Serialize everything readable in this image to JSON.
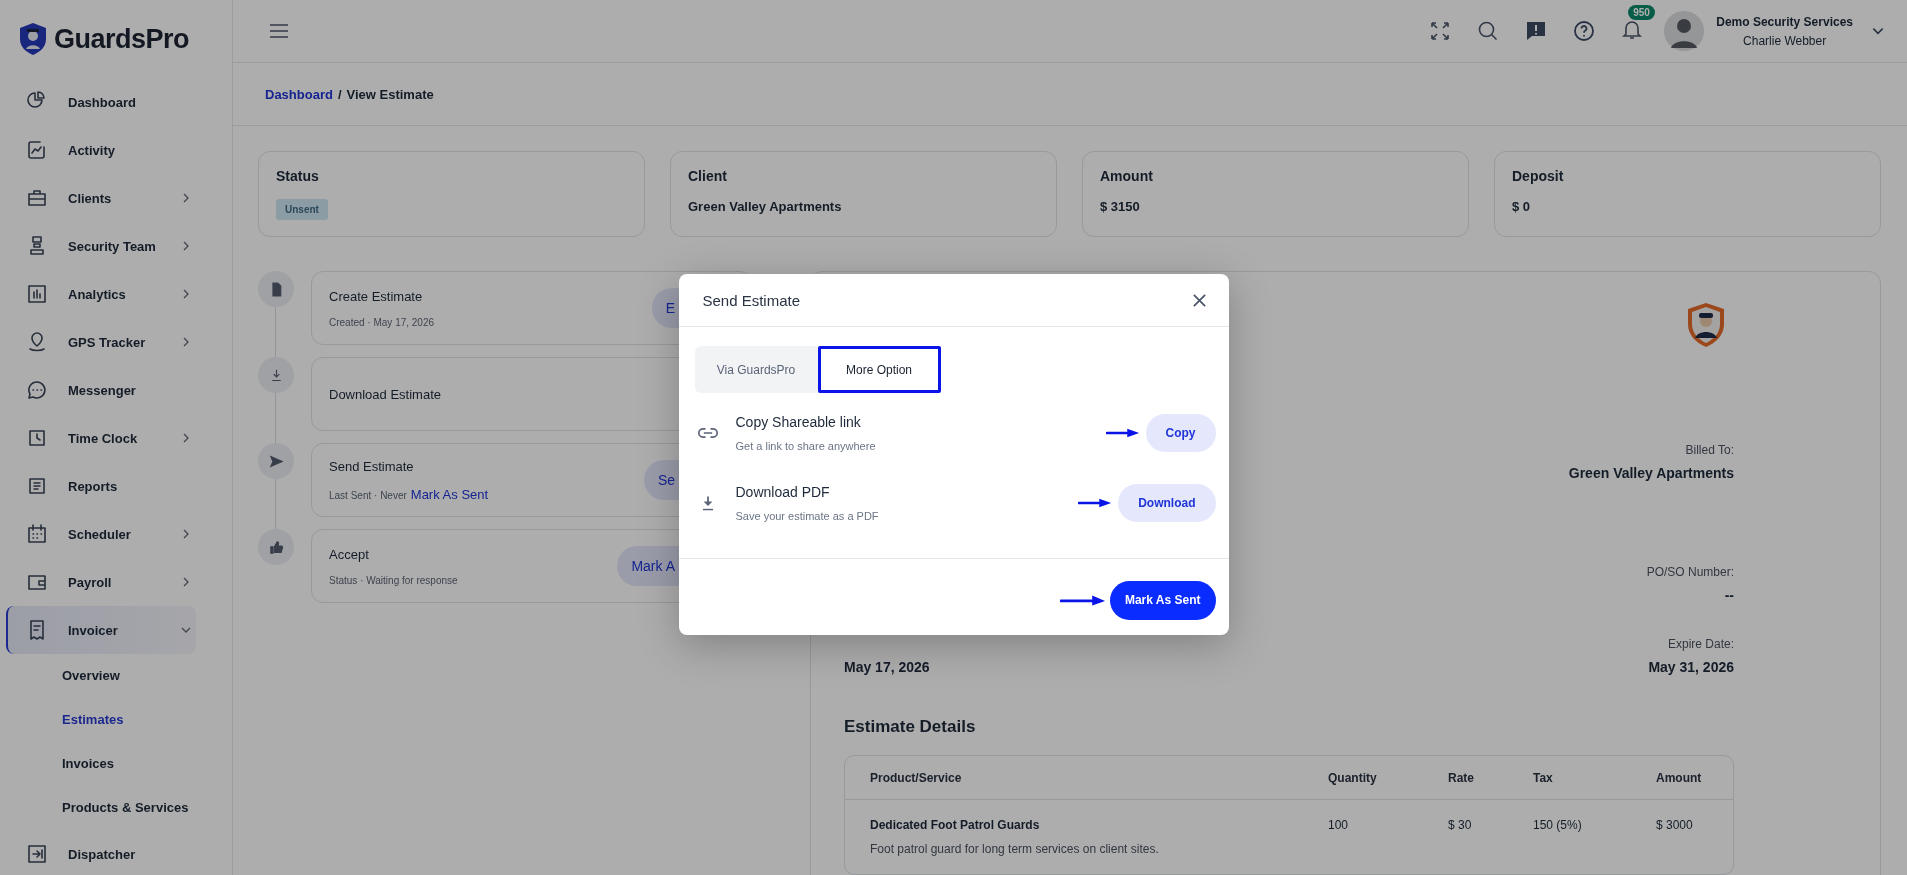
{
  "brand": "GuardsPro",
  "sidebar": {
    "items": [
      {
        "label": "Dashboard",
        "has_submenu": false,
        "selected": false
      },
      {
        "label": "Activity",
        "has_submenu": false,
        "selected": false
      },
      {
        "label": "Clients",
        "has_submenu": true,
        "selected": false
      },
      {
        "label": "Security Team",
        "has_submenu": true,
        "selected": false
      },
      {
        "label": "Analytics",
        "has_submenu": true,
        "selected": false
      },
      {
        "label": "GPS Tracker",
        "has_submenu": true,
        "selected": false
      },
      {
        "label": "Messenger",
        "has_submenu": false,
        "selected": false
      },
      {
        "label": "Time Clock",
        "has_submenu": true,
        "selected": false
      },
      {
        "label": "Reports",
        "has_submenu": false,
        "selected": false
      },
      {
        "label": "Scheduler",
        "has_submenu": true,
        "selected": false
      },
      {
        "label": "Payroll",
        "has_submenu": true,
        "selected": false
      },
      {
        "label": "Invoicer",
        "has_submenu": true,
        "selected": true,
        "expanded": true,
        "children": [
          {
            "label": "Overview",
            "selected": false
          },
          {
            "label": "Estimates",
            "selected": true
          },
          {
            "label": "Invoices",
            "selected": false
          },
          {
            "label": "Products & Services",
            "selected": false
          }
        ]
      },
      {
        "label": "Dispatcher",
        "has_submenu": false,
        "selected": false
      }
    ]
  },
  "header": {
    "notification_count": "950",
    "company": "Demo Security Services",
    "user": "Charlie Webber"
  },
  "breadcrumb": {
    "link": "Dashboard",
    "separator": "/",
    "current": "View Estimate"
  },
  "summary_cards": [
    {
      "kind": "badge",
      "title": "Status",
      "value": "Unsent"
    },
    {
      "kind": "text",
      "title": "Client",
      "value": "Green Valley Apartments"
    },
    {
      "kind": "text",
      "title": "Amount",
      "value": "$ 3150"
    },
    {
      "kind": "text",
      "title": "Deposit",
      "value": "$ 0"
    }
  ],
  "timeline": [
    {
      "title": "Create Estimate",
      "subtitle": "Created · May 17, 2026",
      "action": "E"
    },
    {
      "title": "Download Estimate"
    },
    {
      "title": "Send Estimate",
      "subtitle": "Last Sent · Never",
      "link": "Mark As Sent",
      "action": "Se"
    },
    {
      "title": "Accept",
      "subtitle": "Status · Waiting for response",
      "action": "Mark A"
    }
  ],
  "estimate": {
    "billed_to_label": "Billed To:",
    "billed_to": "Green Valley Apartments",
    "po_label": "PO/SO Number:",
    "po_value": "--",
    "date_issued": "May 17, 2026",
    "expire_label": "Expire Date:",
    "expire_date": "May 31, 2026",
    "details_title": "Estimate Details",
    "columns": [
      "Product/Service",
      "Quantity",
      "Rate",
      "Tax",
      "Amount"
    ],
    "rows": [
      {
        "product": "Dedicated Foot Patrol Guards",
        "description": "Foot patrol guard for long term services on client sites.",
        "quantity": "100",
        "rate": "$ 30",
        "tax": "150 (5%)",
        "amount": "$ 3000"
      }
    ]
  },
  "modal": {
    "title": "Send Estimate",
    "tabs": [
      {
        "label": "Via GuardsPro",
        "selected": false
      },
      {
        "label": "More Option",
        "selected": true
      }
    ],
    "options": [
      {
        "title": "Copy Shareable link",
        "subtitle": "Get a link to share anywhere",
        "button": "Copy"
      },
      {
        "title": "Download PDF",
        "subtitle": "Save your estimate as a PDF",
        "button": "Download"
      }
    ],
    "primary_button": "Mark As Sent"
  }
}
